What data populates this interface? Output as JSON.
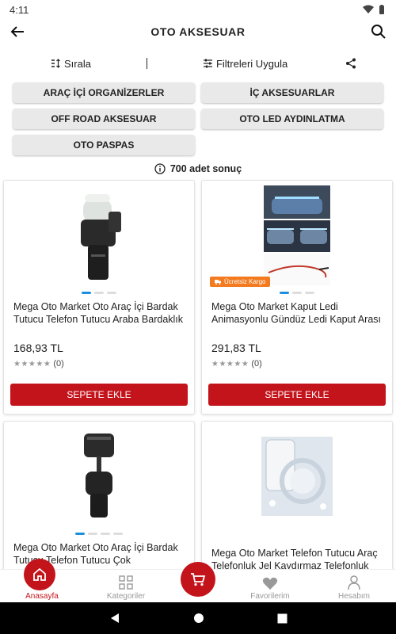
{
  "status": {
    "time": "4:11"
  },
  "header": {
    "title": "OTO AKSESUAR"
  },
  "toolbar": {
    "sort_label": "Sırala",
    "filter_label": "Filtreleri Uygula"
  },
  "categories": [
    "ARAÇ İÇİ ORGANİZERLER",
    "İÇ AKSESUARLAR",
    "OFF ROAD AKSESUAR",
    "OTO LED AYDINLATMA",
    "OTO PASPAS"
  ],
  "results": {
    "count_text": "700 adet sonuç"
  },
  "products": [
    {
      "name": "Mega Oto Market Oto Araç İçi Bardak Tutucu Telefon Tutucu Araba Bardaklık Organizer",
      "price": "168,93 TL",
      "rating_count": "(0)",
      "button": "SEPETE EKLE",
      "badge": ""
    },
    {
      "name": "Mega Oto Market Kaput Ledi Animasyonlu Gündüz Ledi Kaput Arası Led",
      "price": "291,83 TL",
      "rating_count": "(0)",
      "button": "SEPETE EKLE",
      "badge": "Ücretsiz Kargo"
    },
    {
      "name": "Mega Oto Market Oto Araç İçi Bardak Tutucu Telefon Tutucu Çok Fonksiyonlu",
      "price": "",
      "rating_count": "",
      "button": "",
      "badge": ""
    },
    {
      "name": "Mega Oto Market Telefon Tutucu Araç Telefonluk Jel Kaydırmaz Telefonluk Tutucu",
      "price": "",
      "rating_count": "",
      "button": "",
      "badge": ""
    }
  ],
  "nav": {
    "home": "Anasayfa",
    "categories": "Kategoriler",
    "favorites": "Favorilerim",
    "account": "Hesabım"
  },
  "colors": {
    "accent": "#c3141c",
    "badge": "#f37a1f",
    "dot_active": "#1e8fe0"
  }
}
